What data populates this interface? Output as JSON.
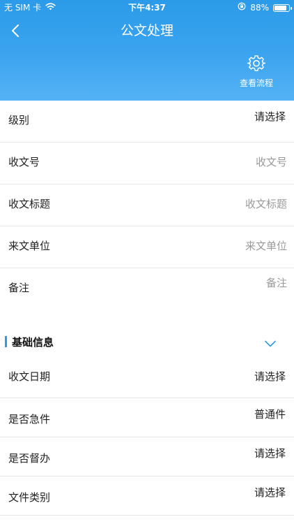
{
  "status": {
    "carrier": "无 SIM 卡",
    "time": "下午4:37",
    "battery_text": "88%",
    "battery_level": 0.88
  },
  "nav": {
    "title": "公文处理",
    "flow_label": "查看流程"
  },
  "form": {
    "level": {
      "label": "级别",
      "value": "请选择"
    },
    "doc_number": {
      "label": "收文号",
      "placeholder": "收文号"
    },
    "doc_title": {
      "label": "收文标题",
      "placeholder": "收文标题"
    },
    "sender_unit": {
      "label": "来文单位",
      "placeholder": "来文单位"
    },
    "remark": {
      "label": "备注",
      "placeholder": "备注"
    }
  },
  "basic_info": {
    "title": "基础信息",
    "rows": [
      {
        "label": "收文日期",
        "value": "请选择"
      },
      {
        "label": "是否急件",
        "value": "普通件"
      },
      {
        "label": "是否督办",
        "value": "请选择"
      },
      {
        "label": "文件类别",
        "value": "请选择"
      }
    ]
  },
  "colors": {
    "accent": "#2b9be9",
    "placeholder": "#9a9a9a",
    "divider": "#e8e8e8"
  }
}
